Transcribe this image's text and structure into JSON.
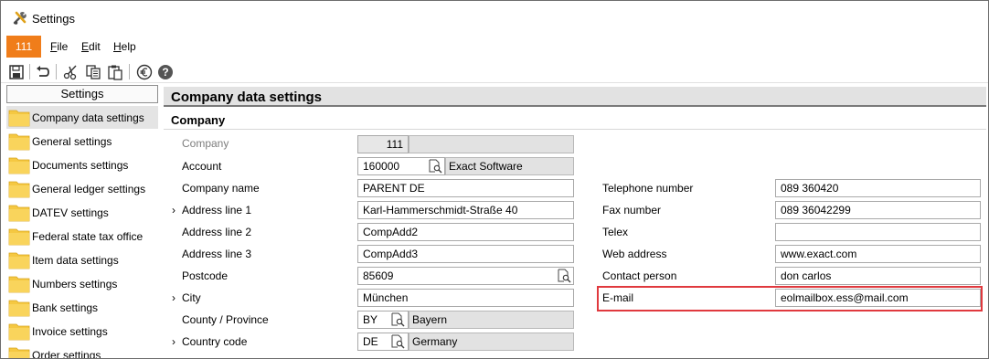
{
  "window": {
    "title": "Settings"
  },
  "menubar": {
    "company_badge": "111",
    "file_label": "File",
    "edit_label": "Edit",
    "help_label": "Help"
  },
  "toolbar": {
    "icons": [
      "save-icon",
      "undo-icon",
      "cut-icon",
      "copy-icon",
      "paste-icon",
      "euro-icon",
      "help-icon"
    ]
  },
  "sidebar": {
    "header": "Settings",
    "items": [
      {
        "label": "Company data settings"
      },
      {
        "label": "General settings"
      },
      {
        "label": "Documents settings"
      },
      {
        "label": "General ledger settings"
      },
      {
        "label": "DATEV settings"
      },
      {
        "label": "Federal state tax office"
      },
      {
        "label": "Item data settings"
      },
      {
        "label": "Numbers settings"
      },
      {
        "label": "Bank settings"
      },
      {
        "label": "Invoice settings"
      },
      {
        "label": "Order settings"
      }
    ]
  },
  "main": {
    "title": "Company data settings",
    "section": "Company",
    "left": {
      "company": {
        "label": "Company",
        "value": "111"
      },
      "account": {
        "label": "Account",
        "value": "160000",
        "description": "Exact Software"
      },
      "company_name": {
        "label": "Company name",
        "value": "PARENT DE"
      },
      "address1": {
        "label": "Address line 1",
        "value": "Karl-Hammerschmidt-Straße 40"
      },
      "address2": {
        "label": "Address line 2",
        "value": "CompAdd2"
      },
      "address3": {
        "label": "Address line 3",
        "value": "CompAdd3"
      },
      "postcode": {
        "label": "Postcode",
        "value": "85609"
      },
      "city": {
        "label": "City",
        "value": "München"
      },
      "county": {
        "label": "County / Province",
        "value": "BY",
        "description": "Bayern"
      },
      "country": {
        "label": "Country code",
        "value": "DE",
        "description": "Germany"
      }
    },
    "right": {
      "telephone": {
        "label": "Telephone number",
        "value": "089 360420"
      },
      "fax": {
        "label": "Fax number",
        "value": "089 36042299"
      },
      "telex": {
        "label": "Telex",
        "value": ""
      },
      "web": {
        "label": "Web address",
        "value": "www.exact.com"
      },
      "contact": {
        "label": "Contact person",
        "value": "don carlos"
      },
      "email": {
        "label": "E-mail",
        "value": "eolmailbox.ess@mail.com"
      }
    }
  },
  "colors": {
    "badge": "#f07d1a",
    "highlight": "#e0393e",
    "folder": "#f5c842"
  }
}
